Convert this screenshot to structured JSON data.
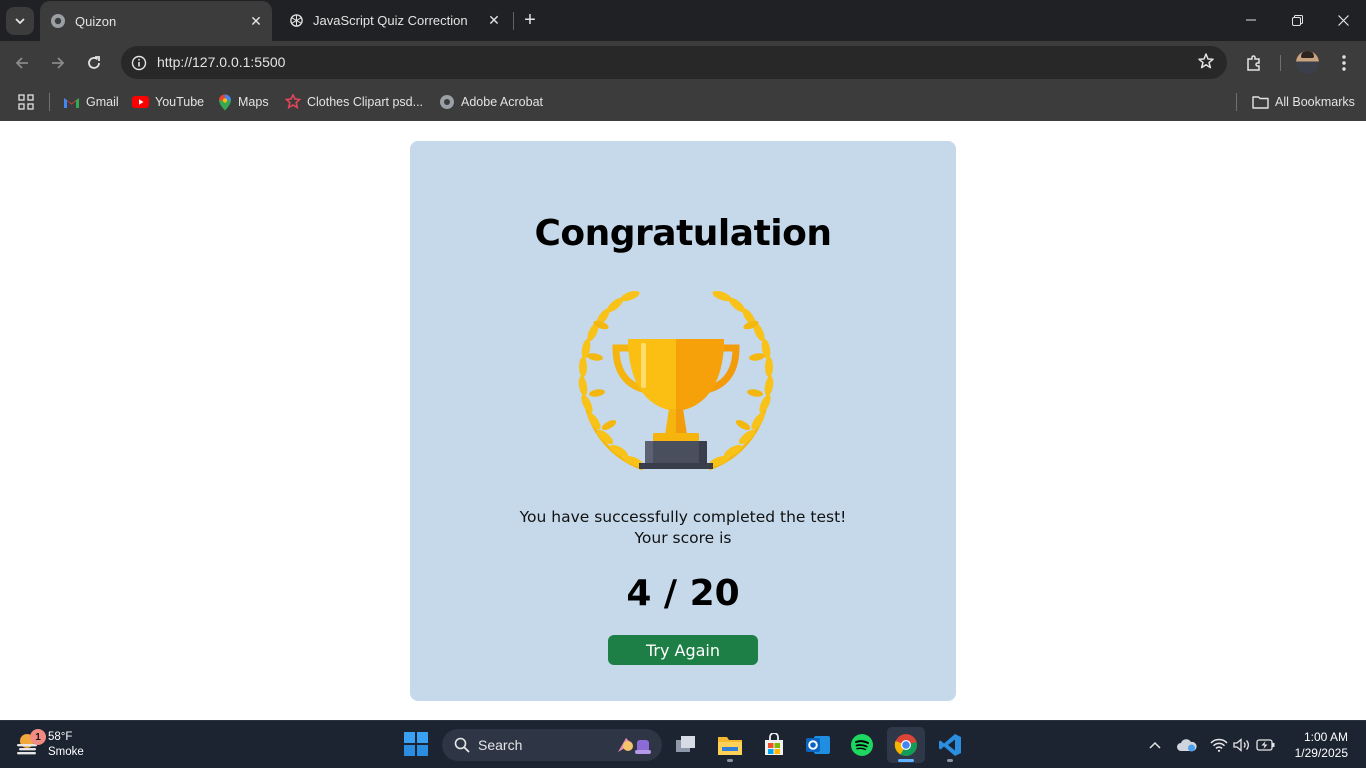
{
  "browser": {
    "tabs": [
      {
        "title": "Quizon",
        "active": true
      },
      {
        "title": "JavaScript Quiz Correction",
        "active": false
      }
    ],
    "url": "http://127.0.0.1:5500",
    "bookmarks": [
      {
        "label": "Gmail",
        "icon": "gmail-icon"
      },
      {
        "label": "YouTube",
        "icon": "youtube-icon"
      },
      {
        "label": "Maps",
        "icon": "maps-icon"
      },
      {
        "label": "Clothes Clipart psd...",
        "icon": "clipart-icon"
      },
      {
        "label": "Adobe Acrobat",
        "icon": "globe-icon"
      }
    ],
    "all_bookmarks_label": "All Bookmarks"
  },
  "page": {
    "title": "Congratulation",
    "message_line1": "You have successfully completed the test!",
    "message_line2": "Your score is",
    "score": "4 / 20",
    "try_again_label": "Try Again",
    "colors": {
      "card_background": "#c5d9eb",
      "button_background": "#1d7f45",
      "trophy_gold": "#f6b40e"
    }
  },
  "taskbar": {
    "weather_temp": "58°F",
    "weather_desc": "Smoke",
    "weather_badge": "1",
    "search_placeholder": "Search",
    "time": "1:00 AM",
    "date": "1/29/2025"
  }
}
